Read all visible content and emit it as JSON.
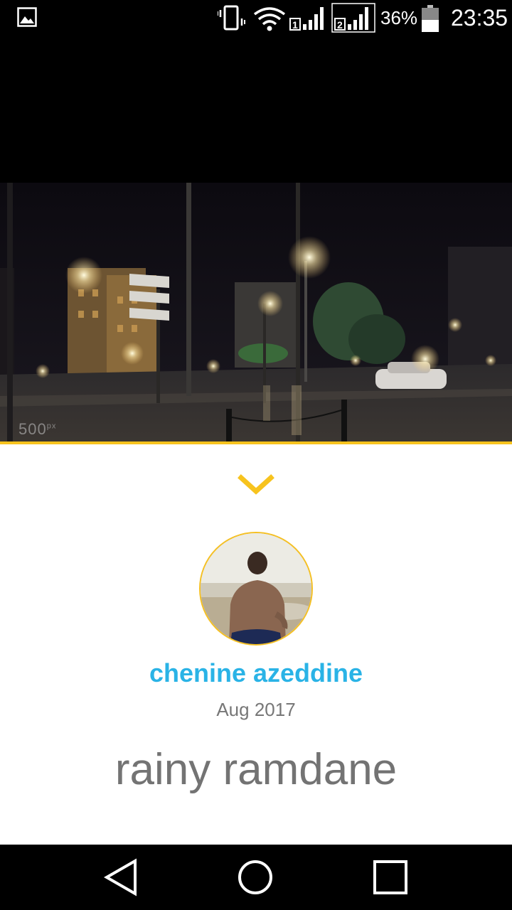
{
  "status_bar": {
    "battery_percent": "36%",
    "time": "23:35",
    "icons": [
      "image-notification-icon",
      "vibrate-icon",
      "wifi-icon",
      "sim1-signal-icon",
      "sim2-signal-icon",
      "battery-icon"
    ]
  },
  "photo": {
    "watermark": "500",
    "watermark_suffix": "px"
  },
  "info": {
    "author": "chenine azeddine",
    "date": "Aug 2017",
    "title": "rainy ramdane"
  },
  "colors": {
    "accent": "#f7c31e",
    "author": "#2ab3e6",
    "text_gray": "#737373"
  },
  "nav_bar": {
    "icons": [
      "back-icon",
      "home-icon",
      "recent-apps-icon"
    ]
  }
}
